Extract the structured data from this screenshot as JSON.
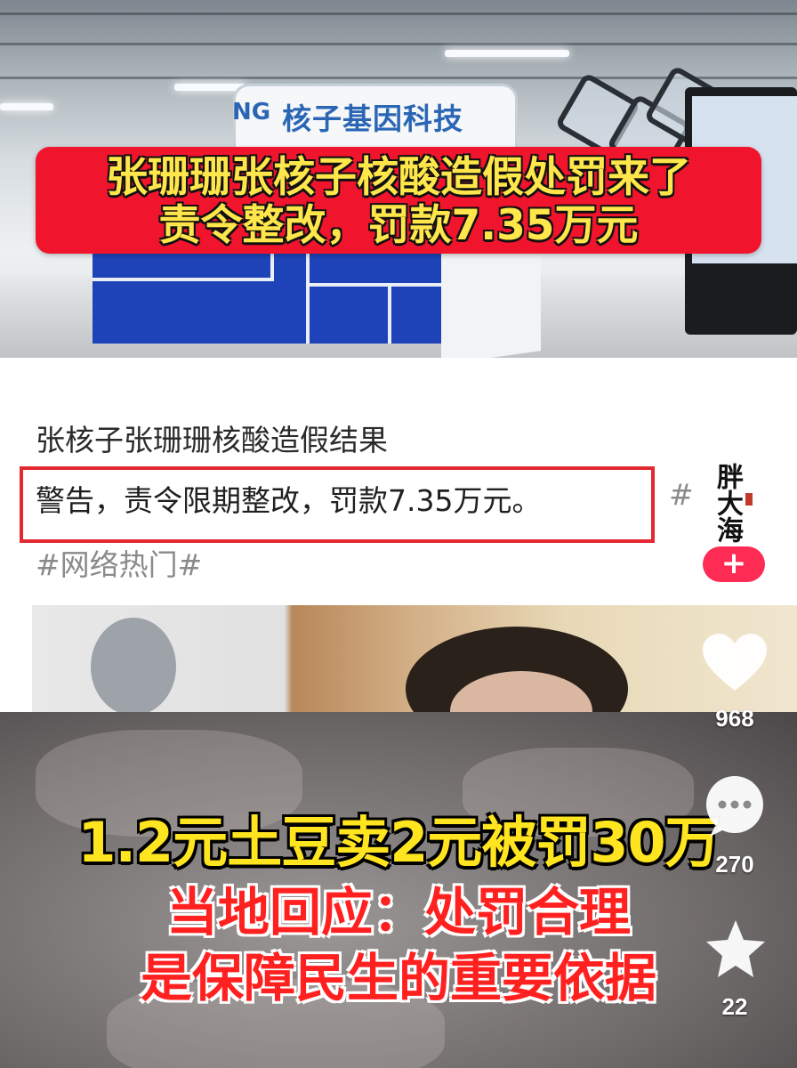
{
  "top_photo": {
    "sign_text": "核子基因科技",
    "sign_logo": "NG",
    "headline_line1": "张珊珊张核子核酸造假处罚来了",
    "headline_line2": "责令整改，罚款7.35万元"
  },
  "post": {
    "title": "张核子张珊珊核酸造假结果",
    "body": "警告，责令限期整改，罚款7.35万元。",
    "hashtag_trail": "#",
    "hashtag": "#网络热门#"
  },
  "bottom_video": {
    "line1": "1.2元土豆卖2元被罚30万",
    "line2": "当地回应：处罚合理",
    "line3": "是保障民生的重要依据"
  },
  "sidebar": {
    "avatar_text": "胖大海",
    "follow_label": "+",
    "likes": "968",
    "comments": "270",
    "favorites": "22"
  },
  "colors": {
    "banner_red": "#f0142d",
    "banner_text": "#ffe64a",
    "highlight_border": "#e32830",
    "follow_pink": "#fe2c55"
  },
  "icons": [
    "heart-icon",
    "comment-icon",
    "star-icon",
    "plus-icon"
  ]
}
